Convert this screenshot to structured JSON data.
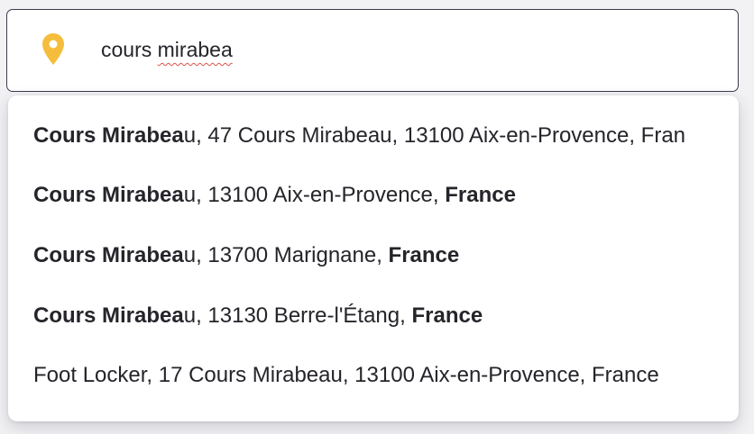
{
  "search": {
    "value_first": "cours ",
    "value_second": "mirabea",
    "icon": "location-pin-icon",
    "icon_color": "#f5bd3c",
    "border_color": "#3a3d4c"
  },
  "suggestions": [
    {
      "bold": "Cours Mirabea",
      "rest": "u, 47 Cours Mirabeau, 13100 Aix-en-Provence, Fran",
      "tail_bold": ""
    },
    {
      "bold": "Cours Mirabea",
      "rest": "u, 13100 Aix-en-Provence, ",
      "tail_bold": "France"
    },
    {
      "bold": "Cours Mirabea",
      "rest": "u, 13700 Marignane, ",
      "tail_bold": "France"
    },
    {
      "bold": "Cours Mirabea",
      "rest": "u, 13130 Berre-l'Étang, ",
      "tail_bold": "France"
    },
    {
      "bold": "",
      "rest": "Foot Locker, 17 Cours Mirabeau, 13100 Aix-en-Provence, France",
      "tail_bold": ""
    }
  ]
}
